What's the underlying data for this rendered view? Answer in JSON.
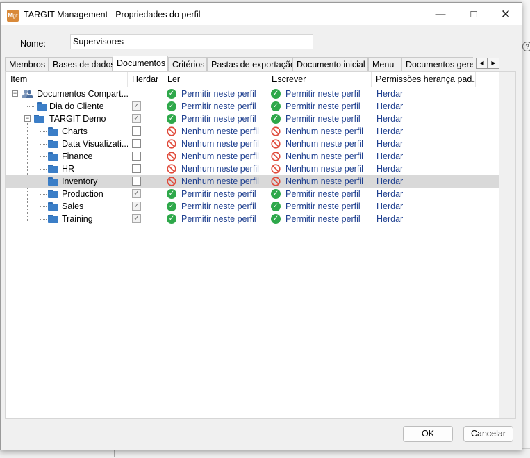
{
  "window": {
    "title": "TARGIT Management - Propriedades do perfil",
    "icon_text": "Mgt"
  },
  "form": {
    "name_label": "Nome:",
    "name_value": "Supervisores"
  },
  "tabs": [
    {
      "label": "Membros"
    },
    {
      "label": "Bases de dados"
    },
    {
      "label": "Documentos"
    },
    {
      "label": "Critérios"
    },
    {
      "label": "Pastas de exportação"
    },
    {
      "label": "Documento inicial"
    },
    {
      "label": "Menu"
    },
    {
      "label": "Documentos gerenciados"
    }
  ],
  "active_tab": "Documentos",
  "columns": {
    "item": "Item",
    "herdar": "Herdar",
    "ler": "Ler",
    "escrever": "Escrever",
    "permissoes": "Permissões herança pad..."
  },
  "rows": [
    {
      "name": "Documentos Compart...",
      "icon": "shared-people-icon",
      "herdar": null,
      "ler": "Permitir neste perfil",
      "ler_status": "allow",
      "escrever": "Permitir neste perfil",
      "escrever_status": "allow",
      "perm": "Herdar"
    },
    {
      "name": "Dia do Cliente",
      "icon": "folder-icon",
      "herdar": true,
      "ler": "Permitir neste perfil",
      "ler_status": "allow",
      "escrever": "Permitir neste perfil",
      "escrever_status": "allow",
      "perm": "Herdar"
    },
    {
      "name": "TARGIT Demo",
      "icon": "folder-icon",
      "herdar": true,
      "ler": "Permitir neste perfil",
      "ler_status": "allow",
      "escrever": "Permitir neste perfil",
      "escrever_status": "allow",
      "perm": "Herdar"
    },
    {
      "name": "Charts",
      "icon": "folder-icon",
      "herdar": false,
      "ler": "Nenhum neste perfil",
      "ler_status": "deny",
      "escrever": "Nenhum neste perfil",
      "escrever_status": "deny",
      "perm": "Herdar"
    },
    {
      "name": "Data Visualizati...",
      "icon": "folder-icon",
      "herdar": false,
      "ler": "Nenhum neste perfil",
      "ler_status": "deny",
      "escrever": "Nenhum neste perfil",
      "escrever_status": "deny",
      "perm": "Herdar"
    },
    {
      "name": "Finance",
      "icon": "folder-icon",
      "herdar": false,
      "ler": "Nenhum neste perfil",
      "ler_status": "deny",
      "escrever": "Nenhum neste perfil",
      "escrever_status": "deny",
      "perm": "Herdar"
    },
    {
      "name": "HR",
      "icon": "folder-icon",
      "herdar": false,
      "ler": "Nenhum neste perfil",
      "ler_status": "deny",
      "escrever": "Nenhum neste perfil",
      "escrever_status": "deny",
      "perm": "Herdar"
    },
    {
      "name": "Inventory",
      "icon": "folder-icon",
      "herdar": false,
      "ler": "Nenhum neste perfil",
      "ler_status": "deny",
      "escrever": "Nenhum neste perfil",
      "escrever_status": "deny",
      "perm": "Herdar",
      "selected": true
    },
    {
      "name": "Production",
      "icon": "folder-icon",
      "herdar": true,
      "ler": "Permitir neste perfil",
      "ler_status": "allow",
      "escrever": "Permitir neste perfil",
      "escrever_status": "allow",
      "perm": "Herdar"
    },
    {
      "name": "Sales",
      "icon": "folder-icon",
      "herdar": true,
      "ler": "Permitir neste perfil",
      "ler_status": "allow",
      "escrever": "Permitir neste perfil",
      "escrever_status": "allow",
      "perm": "Herdar"
    },
    {
      "name": "Training",
      "icon": "folder-icon",
      "herdar": true,
      "ler": "Permitir neste perfil",
      "ler_status": "allow",
      "escrever": "Permitir neste perfil",
      "escrever_status": "allow",
      "perm": "Herdar"
    }
  ],
  "buttons": {
    "ok": "OK",
    "cancel": "Cancelar"
  },
  "colors": {
    "link_blue": "#1e3f8f",
    "allow_green": "#2ea84a",
    "deny_red": "#e04a3a",
    "folder_blue": "#3b7ec7",
    "selected_row": "#d9d9d9"
  }
}
